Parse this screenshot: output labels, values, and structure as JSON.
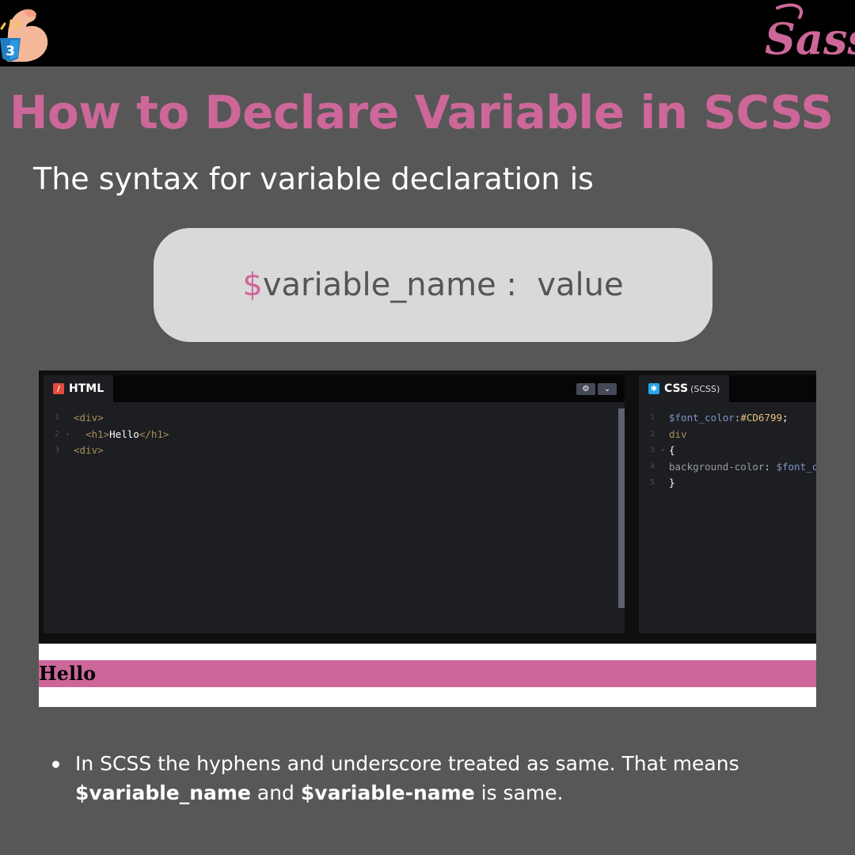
{
  "logos": {
    "left_icon": "css3-shield-flex-arm-icon",
    "right_icon": "sass-logo-icon",
    "left_badge": "3",
    "right_text": "Sass"
  },
  "title": "How to Declare Variable in SCSS",
  "subtitle": "The syntax for variable declaration is",
  "syntax": {
    "dollar": "$",
    "name": "variable_name",
    "separator": " :  ",
    "value": "value"
  },
  "editor": {
    "html_tab": {
      "label": "HTML",
      "icon": "html-slash-icon"
    },
    "css_tab": {
      "label": "CSS",
      "sub": "(SCSS)",
      "icon": "css-asterisk-icon"
    },
    "html_buttons": {
      "settings": "⚙",
      "collapse": "⌄"
    },
    "html_code": {
      "line1": {
        "n": "1",
        "tag": "<div>"
      },
      "line2": {
        "n": "2",
        "fold": "▾",
        "open": "<h1>",
        "text": "Hello",
        "close": "</h1>"
      },
      "line3": {
        "n": "3",
        "tag": "<div>"
      }
    },
    "css_code": {
      "line1": {
        "n": "1",
        "var": "$font_color",
        "colon": ":",
        "hex": "#CD6799",
        "semi": ";"
      },
      "line2": {
        "n": "2",
        "text": "div"
      },
      "line3": {
        "n": "3",
        "fold": "▾",
        "text": "{"
      },
      "line4": {
        "n": "4",
        "prop": "background-color",
        "colon": ": ",
        "var": "$font_color"
      },
      "line5": {
        "n": "5",
        "text": "}"
      }
    }
  },
  "output": {
    "heading": "Hello",
    "bar_color": "#CD6799"
  },
  "note": {
    "part1": "In SCSS the hyphens and underscore treated as same. That means ",
    "bold1": "$variable_name",
    "part2": " and ",
    "bold2": "$variable-name",
    "part3": " is same."
  },
  "colors": {
    "accent": "#CD6799",
    "background": "#575757",
    "topbar": "#000000"
  }
}
